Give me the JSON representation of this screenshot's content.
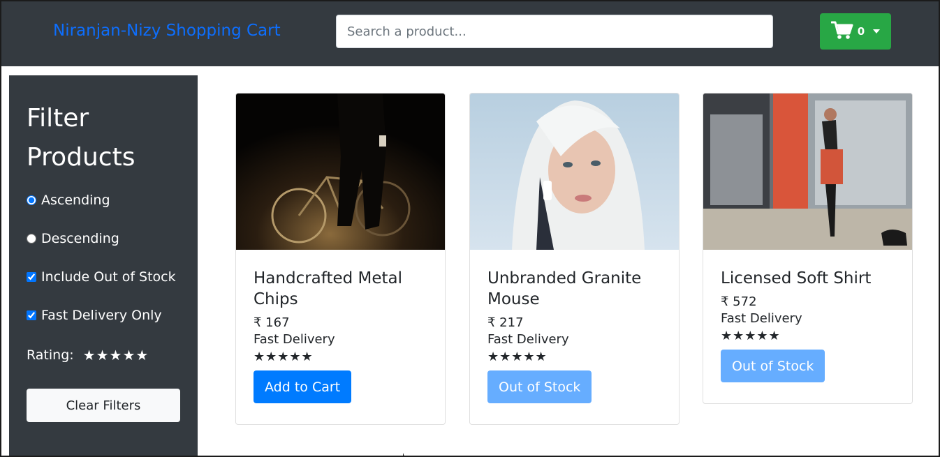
{
  "navbar": {
    "brand": "Niranjan-Nizy Shopping Cart",
    "search_placeholder": "Search a product...",
    "cart_count": "0",
    "cart_icon": "shopping-cart-icon",
    "accent_color": "#0d6efd",
    "cart_button_color": "#28a745"
  },
  "sidebar": {
    "title": "Filter Products",
    "options": {
      "ascending": "Ascending",
      "descending": "Descending",
      "include_out_of_stock": "Include Out of Stock",
      "fast_delivery_only": "Fast Delivery Only"
    },
    "rating_label": "Rating:",
    "rating_stars": "★★★★★",
    "clear_label": "Clear Filters"
  },
  "products": [
    {
      "name": "Handcrafted Metal Chips",
      "price": "₹ 167",
      "delivery": "Fast Delivery",
      "stars": "★★★★★",
      "button": "Add to Cart",
      "in_stock": true
    },
    {
      "name": "Unbranded Granite Mouse",
      "price": "₹ 217",
      "delivery": "Fast Delivery",
      "stars": "★★★★★",
      "button": "Out of Stock",
      "in_stock": false
    },
    {
      "name": "Licensed Soft Shirt",
      "price": "₹ 572",
      "delivery": "Fast Delivery",
      "stars": "★★★★★",
      "button": "Out of Stock",
      "in_stock": false
    }
  ]
}
